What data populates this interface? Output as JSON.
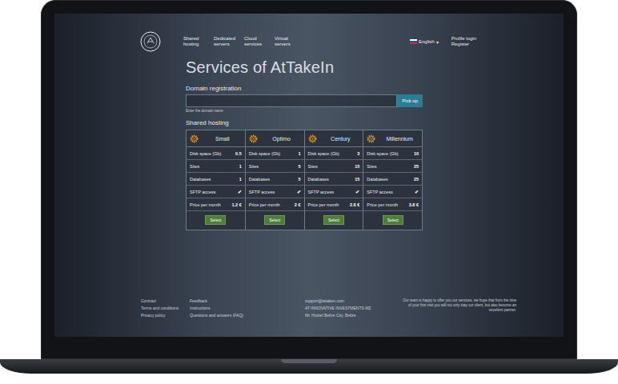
{
  "nav": [
    {
      "label": "Shared hosting"
    },
    {
      "label": "Dedicated servers"
    },
    {
      "label": "Cloud services"
    },
    {
      "label": "Virtual servers"
    }
  ],
  "language": {
    "label": "English",
    "caret": "▾"
  },
  "account_links": [
    "Profile login",
    "Register"
  ],
  "page_title": "Services of AtTakeIn",
  "domain": {
    "label": "Domain registration",
    "placeholder": "",
    "hint": "Enter the domain name",
    "button": "Pick up"
  },
  "hosting": {
    "title": "Shared hosting",
    "plans": [
      {
        "name": "Small",
        "rows": [
          {
            "label": "Disk space (Gb)",
            "value": "0.5"
          },
          {
            "label": "Sites",
            "value": "1"
          },
          {
            "label": "Databases",
            "value": "1"
          },
          {
            "label": "SFTP access",
            "value": "✔"
          },
          {
            "label": "Price per month",
            "value": "1.2 €"
          }
        ],
        "button": "Select"
      },
      {
        "name": "Optimo",
        "rows": [
          {
            "label": "Disk space (Gb)",
            "value": "1"
          },
          {
            "label": "Sites",
            "value": "5"
          },
          {
            "label": "Databases",
            "value": "5"
          },
          {
            "label": "SFTP access",
            "value": "✔"
          },
          {
            "label": "Price per month",
            "value": "2 €"
          }
        ],
        "button": "Select"
      },
      {
        "name": "Century",
        "rows": [
          {
            "label": "Disk space (Gb)",
            "value": "3"
          },
          {
            "label": "Sites",
            "value": "15"
          },
          {
            "label": "Databases",
            "value": "15"
          },
          {
            "label": "SFTP access",
            "value": "✔"
          },
          {
            "label": "Price per month",
            "value": "2.8 €"
          }
        ],
        "button": "Select"
      },
      {
        "name": "Millennium",
        "rows": [
          {
            "label": "Disk space (Gb)",
            "value": "10"
          },
          {
            "label": "Sites",
            "value": "25"
          },
          {
            "label": "Databases",
            "value": "25"
          },
          {
            "label": "SFTP access",
            "value": "✔"
          },
          {
            "label": "Price per month",
            "value": "3.8 €"
          }
        ],
        "button": "Select"
      }
    ]
  },
  "footer": {
    "columns": [
      [
        "Contract",
        "Terms and conditions",
        "Privacy policy"
      ],
      [
        "Feedback",
        "Instructions",
        "Questions and answers (FAQ)"
      ]
    ],
    "contact": [
      "support@attaken.com",
      "AT INNOVATIVE INVESTMENTS MZ",
      "Mr. Hostel Belize City, Belize"
    ],
    "note": "Our team is happy to offer you our services, we hope that from the time of your first visit you will not only stay our client, but also become an excellent partner."
  }
}
